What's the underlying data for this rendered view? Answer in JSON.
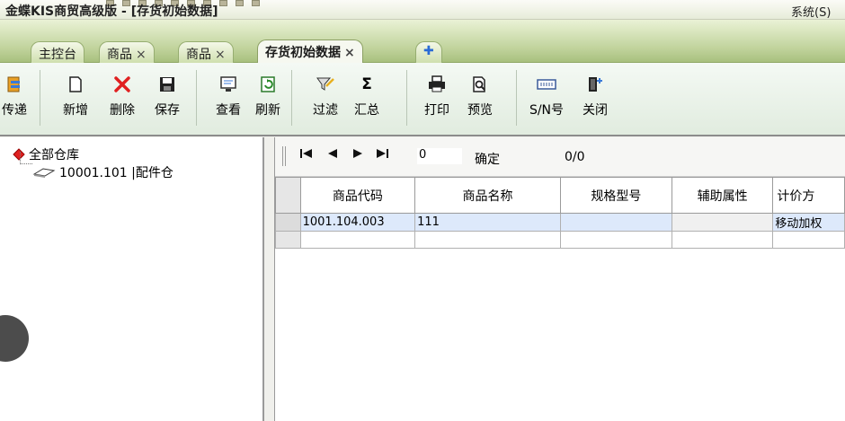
{
  "window": {
    "title": "金蝶KIS商贸高级版 - [存货初始数据]",
    "right_text": "系统(S)"
  },
  "tabs": [
    {
      "label": "主控台",
      "closable": false
    },
    {
      "label": "商品",
      "closable": true
    },
    {
      "label": "商品",
      "closable": true
    },
    {
      "label": "存货初始数据",
      "closable": true,
      "active": true
    }
  ],
  "tab_close_glyph": "×",
  "tab_add_glyph": "✚",
  "toolbar": {
    "transfer": "传递",
    "new": "新增",
    "delete": "删除",
    "save": "保存",
    "view": "查看",
    "refresh": "刷新",
    "filter": "过滤",
    "summary": "汇总",
    "print": "打印",
    "preview": "预览",
    "sn": "S/N号",
    "close": "关闭"
  },
  "tree": {
    "root": "全部仓库",
    "child": "10001.101 |配件仓"
  },
  "nav": {
    "page_value": "0",
    "confirm": "确定",
    "count": "0/0"
  },
  "grid": {
    "columns": [
      "商品代码",
      "商品名称",
      "规格型号",
      "辅助属性",
      "计价方"
    ],
    "rows": [
      [
        "1001.104.003",
        "111",
        "",
        "",
        "移动加权"
      ],
      [
        "",
        "",
        "",
        "",
        ""
      ]
    ]
  },
  "colors": {
    "tab_strip": "#bfd29a",
    "selected_row": "#dde9fb",
    "toolbar_bg": "#e1ecdf"
  }
}
